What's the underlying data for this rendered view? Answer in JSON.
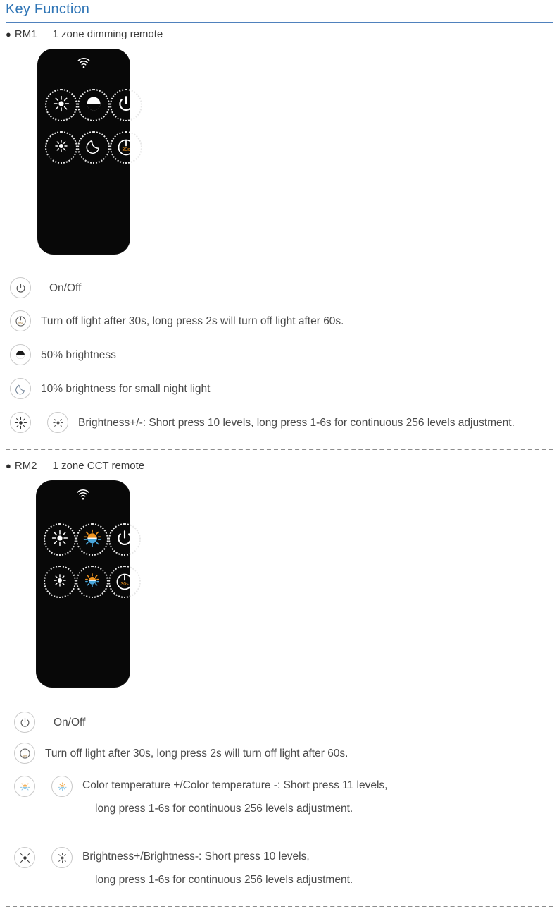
{
  "header": {
    "title": "Key Function",
    "rule_color": "#4f81bd"
  },
  "sections": [
    {
      "id": "rm1",
      "bullet": "●",
      "code": "RM1",
      "name": "1 zone dimming remote",
      "remote": {
        "wifi_icon": "wifi-icon",
        "keys": [
          {
            "name": "brightness-up-key",
            "icon": "sun-bright-icon"
          },
          {
            "name": "half-brightness-key",
            "icon": "half-circle-icon"
          },
          {
            "name": "power-key",
            "icon": "power-icon"
          },
          {
            "name": "brightness-down-key",
            "icon": "sun-dim-icon"
          },
          {
            "name": "night-light-key",
            "icon": "moon-star-icon"
          },
          {
            "name": "timer-off-key",
            "icon": "timer-30s-icon",
            "badge": "30s"
          }
        ]
      },
      "legend": [
        {
          "icons": [
            "power-icon"
          ],
          "text": "On/Off"
        },
        {
          "icons": [
            "timer-30s-icon"
          ],
          "text": "Turn off light after 30s, long press 2s will turn off light after 60s."
        },
        {
          "icons": [
            "half-circle-icon"
          ],
          "text": "50% brightness"
        },
        {
          "icons": [
            "moon-star-icon"
          ],
          "text": "10% brightness for small night light"
        },
        {
          "icons": [
            "sun-bright-icon",
            "sun-dim-icon"
          ],
          "text": "Brightness+/-: Short press 10 levels, long press 1-6s for continuous 256 levels adjustment."
        }
      ]
    },
    {
      "id": "rm2",
      "bullet": "●",
      "code": "RM2",
      "name": "1 zone CCT remote",
      "remote": {
        "wifi_icon": "wifi-icon",
        "keys": [
          {
            "name": "brightness-up-key",
            "icon": "sun-bright-icon"
          },
          {
            "name": "cct-up-key",
            "icon": "cct-icon"
          },
          {
            "name": "power-key",
            "icon": "power-icon"
          },
          {
            "name": "brightness-down-key",
            "icon": "sun-dim-icon"
          },
          {
            "name": "cct-down-key",
            "icon": "cct-small-icon"
          },
          {
            "name": "timer-off-key",
            "icon": "timer-30s-icon",
            "badge": "30s"
          }
        ]
      },
      "legend": [
        {
          "icons": [
            "power-icon"
          ],
          "text": "On/Off"
        },
        {
          "icons": [
            "timer-30s-icon"
          ],
          "text": "Turn off light after 30s, long press 2s will turn off light after 60s."
        },
        {
          "icons": [
            "cct-pale-icon",
            "cct-pale-icon"
          ],
          "line1": "Color temperature +/Color temperature -: Short press 11 levels,",
          "line2": "long press 1-6s for continuous 256 levels adjustment."
        },
        {
          "icons": [
            "sun-bright-icon",
            "sun-dim-icon"
          ],
          "line1": "Brightness+/Brightness-: Short press 10 levels,",
          "line2": "long press 1-6s for continuous 256 levels adjustment."
        }
      ]
    }
  ],
  "colors": {
    "accent_blue": "#2e74b5",
    "rule_blue": "#4f81bd",
    "body_text": "#4a4a4a",
    "remote_body": "#080808",
    "key_outline": "#e8e8e8",
    "cct_warm": "#f0941f",
    "cct_cool": "#4aa8dd",
    "badge_orange": "#f0941f",
    "separator": "#8c8c8c"
  }
}
